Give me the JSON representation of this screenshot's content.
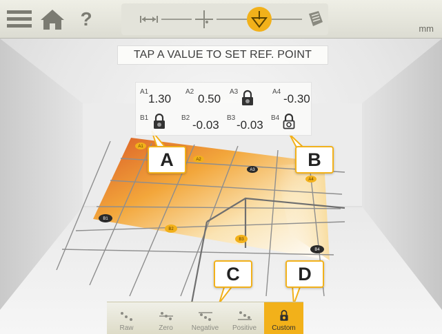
{
  "topbar": {
    "help_label": "?",
    "units": "mm",
    "steps": [
      "measure-span-icon",
      "crosshair-icon",
      "reference-point-icon",
      "report-icon"
    ],
    "active_step": 2
  },
  "instruction": "TAP A VALUE TO SET REF. POINT",
  "values": {
    "a1": {
      "label": "A1",
      "value": "1.30"
    },
    "a2": {
      "label": "A2",
      "value": "0.50"
    },
    "a3": {
      "label": "A3",
      "locked": true
    },
    "a4": {
      "label": "A4",
      "value": "-0.30"
    },
    "b1": {
      "label": "B1",
      "locked": true
    },
    "b2": {
      "label": "B2",
      "value": "-0.03"
    },
    "b3": {
      "label": "B3",
      "value": "-0.03"
    },
    "b4": {
      "label": "B4",
      "locked": true
    }
  },
  "callouts": {
    "a": "A",
    "b": "B",
    "c": "C",
    "d": "D"
  },
  "points": {
    "a1": "A1",
    "a2": "A2",
    "a3": "A3",
    "a4": "A4",
    "b1": "B1",
    "b2": "B2",
    "b3": "B3",
    "b4": "B4"
  },
  "modes": [
    {
      "label": "Raw",
      "active": false
    },
    {
      "label": "Zero",
      "active": false
    },
    {
      "label": "Negative",
      "active": false
    },
    {
      "label": "Positive",
      "active": false
    },
    {
      "label": "Custom",
      "active": true
    }
  ],
  "colors": {
    "accent": "#f2b11a",
    "dark_point": "#2a2a2a"
  }
}
